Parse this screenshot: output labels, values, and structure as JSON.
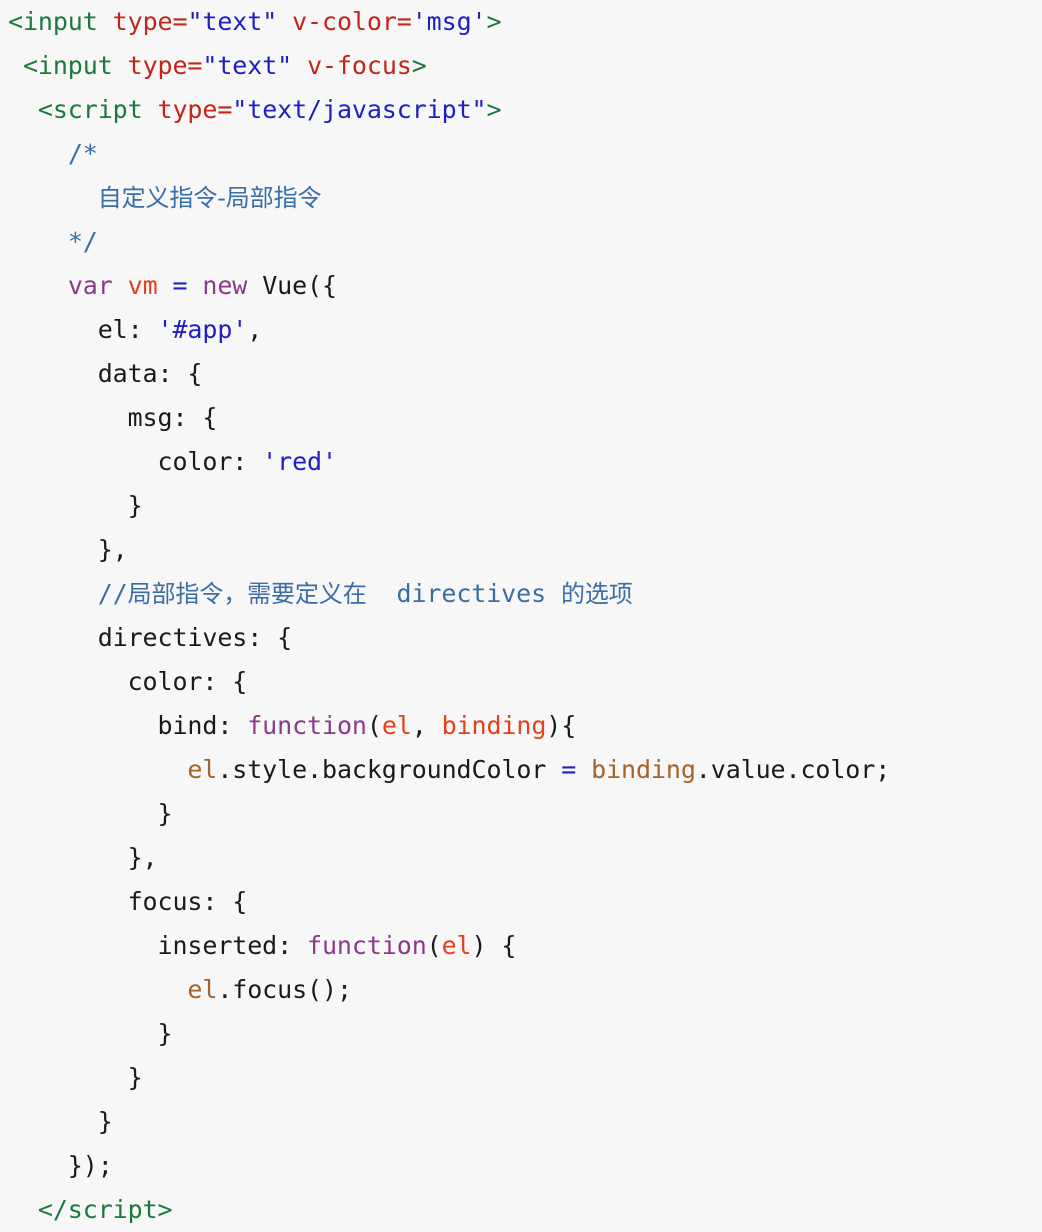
{
  "editor": {
    "background_color": "#f7f7f7",
    "font_size_px": 25,
    "line_height_px": 44,
    "language": "html"
  },
  "palette": {
    "tag": "#1a7a3c",
    "attribute": "#c0261a",
    "string": "#2020c0",
    "comment": "#3a6ea5",
    "keyword": "#8b3a8b",
    "parameter": "#e8401c",
    "reference": "#a5622a",
    "operator": "#2020c0",
    "plain": "#1a1a1a"
  },
  "code": {
    "lines": [
      {
        "n": 1,
        "tokens": [
          {
            "t": "tag",
            "v": "<input "
          },
          {
            "t": "attr",
            "v": "type="
          },
          {
            "t": "str",
            "v": "\"text\""
          },
          {
            "t": "plain",
            "v": " "
          },
          {
            "t": "attr",
            "v": "v-color="
          },
          {
            "t": "str",
            "v": "'msg'"
          },
          {
            "t": "tag",
            "v": ">"
          }
        ]
      },
      {
        "n": 2,
        "tokens": [
          {
            "t": "plain",
            "v": " "
          },
          {
            "t": "tag",
            "v": "<input "
          },
          {
            "t": "attr",
            "v": "type="
          },
          {
            "t": "str",
            "v": "\"text\""
          },
          {
            "t": "plain",
            "v": " "
          },
          {
            "t": "attr",
            "v": "v-focus"
          },
          {
            "t": "tag",
            "v": ">"
          }
        ]
      },
      {
        "n": 3,
        "tokens": [
          {
            "t": "plain",
            "v": "  "
          },
          {
            "t": "tag",
            "v": "<script "
          },
          {
            "t": "attr",
            "v": "type="
          },
          {
            "t": "str",
            "v": "\"text/javascript\""
          },
          {
            "t": "tag",
            "v": ">"
          }
        ]
      },
      {
        "n": 4,
        "tokens": [
          {
            "t": "plain",
            "v": "    "
          },
          {
            "t": "cmt",
            "v": "/*"
          }
        ]
      },
      {
        "n": 5,
        "tokens": [
          {
            "t": "plain",
            "v": "      "
          },
          {
            "t": "cjk",
            "v": "自定义指令-局部指令"
          }
        ]
      },
      {
        "n": 6,
        "tokens": [
          {
            "t": "plain",
            "v": "    "
          },
          {
            "t": "cmt",
            "v": "*/"
          }
        ]
      },
      {
        "n": 7,
        "tokens": [
          {
            "t": "plain",
            "v": "    "
          },
          {
            "t": "kw",
            "v": "var"
          },
          {
            "t": "plain",
            "v": " "
          },
          {
            "t": "param",
            "v": "vm"
          },
          {
            "t": "plain",
            "v": " "
          },
          {
            "t": "op",
            "v": "="
          },
          {
            "t": "plain",
            "v": " "
          },
          {
            "t": "kw",
            "v": "new"
          },
          {
            "t": "plain",
            "v": " Vue({"
          }
        ]
      },
      {
        "n": 8,
        "tokens": [
          {
            "t": "plain",
            "v": "      el: "
          },
          {
            "t": "str",
            "v": "'#app'"
          },
          {
            "t": "plain",
            "v": ","
          }
        ]
      },
      {
        "n": 9,
        "tokens": [
          {
            "t": "plain",
            "v": "      data: {"
          }
        ]
      },
      {
        "n": 10,
        "tokens": [
          {
            "t": "plain",
            "v": "        msg: {"
          }
        ]
      },
      {
        "n": 11,
        "tokens": [
          {
            "t": "plain",
            "v": "          color: "
          },
          {
            "t": "str",
            "v": "'red'"
          }
        ]
      },
      {
        "n": 12,
        "tokens": [
          {
            "t": "plain",
            "v": "        }"
          }
        ]
      },
      {
        "n": 13,
        "tokens": [
          {
            "t": "plain",
            "v": "      },"
          }
        ]
      },
      {
        "n": 14,
        "tokens": [
          {
            "t": "plain",
            "v": "      "
          },
          {
            "t": "cmt",
            "v": "//"
          },
          {
            "t": "cjk",
            "v": "局部指令，需要定义在"
          },
          {
            "t": "cmt",
            "v": "  directives "
          },
          {
            "t": "cjk",
            "v": "的选项"
          }
        ]
      },
      {
        "n": 15,
        "tokens": [
          {
            "t": "plain",
            "v": "      directives: {"
          }
        ]
      },
      {
        "n": 16,
        "tokens": [
          {
            "t": "plain",
            "v": "        color: {"
          }
        ]
      },
      {
        "n": 17,
        "tokens": [
          {
            "t": "plain",
            "v": "          bind: "
          },
          {
            "t": "kw",
            "v": "function"
          },
          {
            "t": "plain",
            "v": "("
          },
          {
            "t": "param",
            "v": "el"
          },
          {
            "t": "plain",
            "v": ", "
          },
          {
            "t": "param",
            "v": "binding"
          },
          {
            "t": "plain",
            "v": "){"
          }
        ]
      },
      {
        "n": 18,
        "tokens": [
          {
            "t": "plain",
            "v": "            "
          },
          {
            "t": "ref",
            "v": "el"
          },
          {
            "t": "plain",
            "v": ".style.backgroundColor "
          },
          {
            "t": "op",
            "v": "="
          },
          {
            "t": "plain",
            "v": " "
          },
          {
            "t": "ref",
            "v": "binding"
          },
          {
            "t": "plain",
            "v": ".value.color;"
          }
        ]
      },
      {
        "n": 19,
        "tokens": [
          {
            "t": "plain",
            "v": "          }"
          }
        ]
      },
      {
        "n": 20,
        "tokens": [
          {
            "t": "plain",
            "v": "        },"
          }
        ]
      },
      {
        "n": 21,
        "tokens": [
          {
            "t": "plain",
            "v": "        focus: {"
          }
        ]
      },
      {
        "n": 22,
        "tokens": [
          {
            "t": "plain",
            "v": "          inserted: "
          },
          {
            "t": "kw",
            "v": "function"
          },
          {
            "t": "plain",
            "v": "("
          },
          {
            "t": "param",
            "v": "el"
          },
          {
            "t": "plain",
            "v": ") {"
          }
        ]
      },
      {
        "n": 23,
        "tokens": [
          {
            "t": "plain",
            "v": "            "
          },
          {
            "t": "ref",
            "v": "el"
          },
          {
            "t": "plain",
            "v": ".focus();"
          }
        ]
      },
      {
        "n": 24,
        "tokens": [
          {
            "t": "plain",
            "v": "          }"
          }
        ]
      },
      {
        "n": 25,
        "tokens": [
          {
            "t": "plain",
            "v": "        }"
          }
        ]
      },
      {
        "n": 26,
        "tokens": [
          {
            "t": "plain",
            "v": "      }"
          }
        ]
      },
      {
        "n": 27,
        "tokens": [
          {
            "t": "plain",
            "v": "    });"
          }
        ]
      },
      {
        "n": 28,
        "tokens": [
          {
            "t": "plain",
            "v": "  "
          },
          {
            "t": "tag",
            "v": "</script>"
          }
        ]
      }
    ]
  }
}
